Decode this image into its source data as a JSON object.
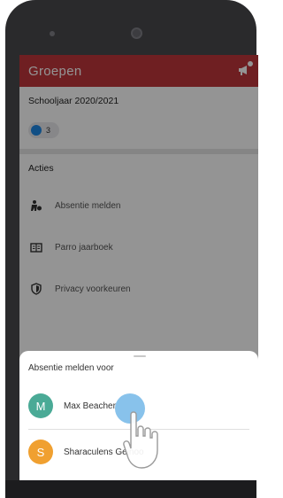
{
  "appbar": {
    "title": "Groepen",
    "icon": "megaphone-icon"
  },
  "school_year": {
    "label": "Schooljaar 2020/2021",
    "group_count": "3"
  },
  "acties": {
    "title": "Acties",
    "items": [
      {
        "label": "Absentie melden",
        "icon": "absence-icon"
      },
      {
        "label": "Parro jaarboek",
        "icon": "book-icon"
      },
      {
        "label": "Privacy voorkeuren",
        "icon": "shield-icon"
      }
    ]
  },
  "sheet": {
    "title": "Absentie melden voor",
    "people": [
      {
        "initial": "M",
        "name": "Max Beacher",
        "color": "#4aaa96"
      },
      {
        "initial": "S",
        "name": "Sharaculens Geinoo",
        "color": "#f0a030"
      }
    ]
  },
  "colors": {
    "accent": "#c0363b",
    "group_dot": "#1e88e5"
  }
}
